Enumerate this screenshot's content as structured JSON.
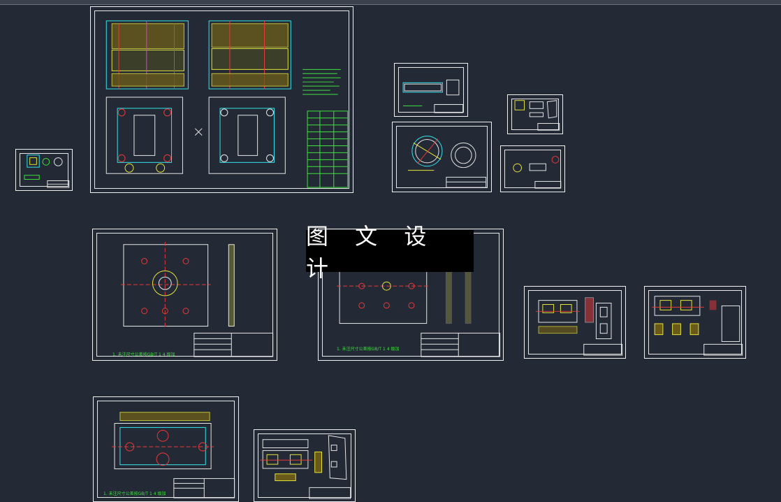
{
  "watermark": {
    "text": "图 文 设 计"
  },
  "drawings": [
    {
      "id": "small-left"
    },
    {
      "id": "main-assembly"
    },
    {
      "id": "part-a"
    },
    {
      "id": "part-b"
    },
    {
      "id": "ring-part"
    },
    {
      "id": "part-c"
    },
    {
      "id": "plate-1",
      "note": "1. 未注尺寸公差按GB/T 1 4 级加"
    },
    {
      "id": "plate-2",
      "note": "1. 未注尺寸公差按GB/T 1 4 级加"
    },
    {
      "id": "insert-1"
    },
    {
      "id": "insert-2"
    },
    {
      "id": "plate-3",
      "note": "1. 未注尺寸公差按GB/T 1 4 级加"
    },
    {
      "id": "insert-3"
    }
  ],
  "colors": {
    "background": "#232935",
    "border": "#f2f2f2",
    "cyan": "#35e7ee",
    "green": "#3ee33e",
    "yellow": "#e8e63a",
    "red": "#e83a3a",
    "magenta": "#e83ae8",
    "white": "#ffffff"
  }
}
